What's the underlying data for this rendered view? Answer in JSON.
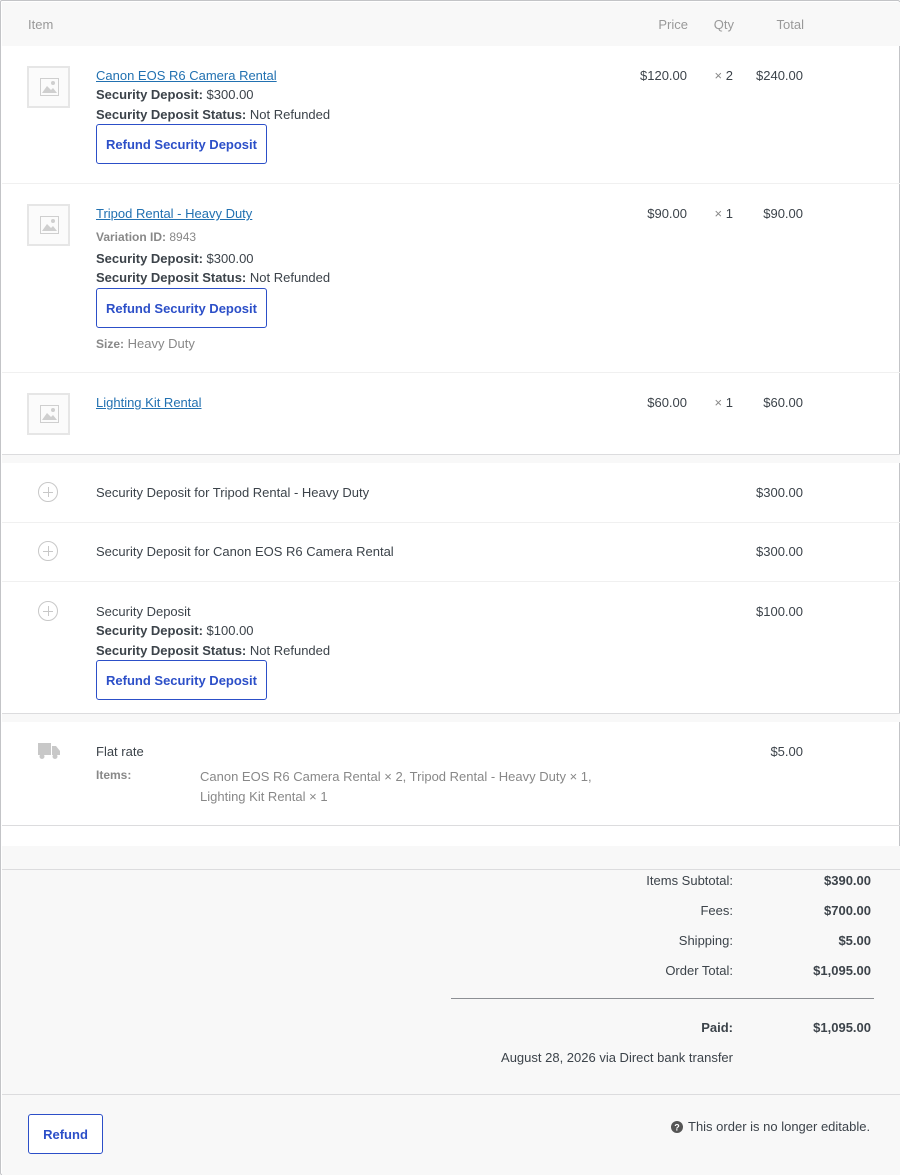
{
  "header": {
    "item": "Item",
    "price": "Price",
    "qty": "Qty",
    "total": "Total"
  },
  "line_items": [
    {
      "name": "Canon EOS R6 Camera Rental",
      "price": "$120.00",
      "qty_mark": "×",
      "qty": "2",
      "total": "$240.00",
      "deposit_label": "Security Deposit:",
      "deposit_value": "$300.00",
      "status_label": "Security Deposit Status:",
      "status_value": "Not Refunded",
      "button": "Refund Security Deposit"
    },
    {
      "name": "Tripod Rental - Heavy Duty",
      "price": "$90.00",
      "qty_mark": "×",
      "qty": "1",
      "total": "$90.00",
      "variation_label": "Variation ID:",
      "variation_value": "8943",
      "deposit_label": "Security Deposit:",
      "deposit_value": "$300.00",
      "status_label": "Security Deposit Status:",
      "status_value": "Not Refunded",
      "button": "Refund Security Deposit",
      "meta_label": "Size:",
      "meta_value": "Heavy Duty"
    },
    {
      "name": "Lighting Kit Rental",
      "price": "$60.00",
      "qty_mark": "×",
      "qty": "1",
      "total": "$60.00"
    }
  ],
  "fees": [
    {
      "name": "Security Deposit for Tripod Rental - Heavy Duty",
      "total": "$300.00"
    },
    {
      "name": "Security Deposit for Canon EOS R6 Camera Rental",
      "total": "$300.00"
    },
    {
      "name": "Security Deposit",
      "total": "$100.00",
      "deposit_label": "Security Deposit:",
      "deposit_value": "$100.00",
      "status_label": "Security Deposit Status:",
      "status_value": "Not Refunded",
      "button": "Refund Security Deposit"
    }
  ],
  "shipping": {
    "name": "Flat rate",
    "total": "$5.00",
    "items_label": "Items:",
    "items_line1": "Canon EOS R6 Camera Rental × 2, Tripod Rental - Heavy Duty × 1,",
    "items_line2": "Lighting Kit Rental × 1"
  },
  "totals": {
    "subtotal_label": "Items Subtotal:",
    "subtotal_value": "$390.00",
    "fees_label": "Fees:",
    "fees_value": "$700.00",
    "shipping_label": "Shipping:",
    "shipping_value": "$5.00",
    "order_total_label": "Order Total:",
    "order_total_value": "$1,095.00",
    "paid_label": "Paid:",
    "paid_value": "$1,095.00",
    "paid_note": "August 28, 2026 via Direct bank transfer"
  },
  "footer": {
    "refund_button": "Refund",
    "notice": "This order is no longer editable."
  },
  "colors": {
    "accent": "#2c4fc8",
    "link": "#2271b1",
    "band": "#f8f8f8"
  }
}
